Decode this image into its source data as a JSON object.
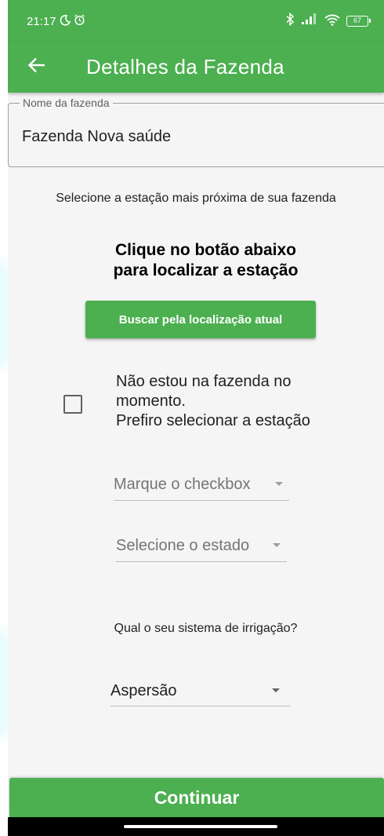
{
  "status_bar": {
    "time": "21:17",
    "battery": "67"
  },
  "app_bar": {
    "title": "Detalhes da Fazenda"
  },
  "farm_name_field": {
    "label": "Nome da fazenda",
    "value": "Fazenda Nova saúde"
  },
  "instruction": "Selecione a estação mais próxima de sua fazenda",
  "heading": {
    "line1": "Clique no botão abaixo",
    "line2": "para localizar a estação"
  },
  "locate_button": "Buscar pela localização atual",
  "manual_checkbox": {
    "checked": false,
    "line1": "Não estou na fazenda no",
    "line2": "momento.",
    "line3": "Prefiro selecionar a estação"
  },
  "dropdowns": {
    "station_hint": "Marque o checkbox",
    "state_hint": "Selecione o estado"
  },
  "irrigation": {
    "question": "Qual o seu sistema de irrigação?",
    "selected": "Aspersão"
  },
  "continue_button": "Continuar",
  "colors": {
    "primary": "#4caf50",
    "background": "#f5f5f5"
  }
}
